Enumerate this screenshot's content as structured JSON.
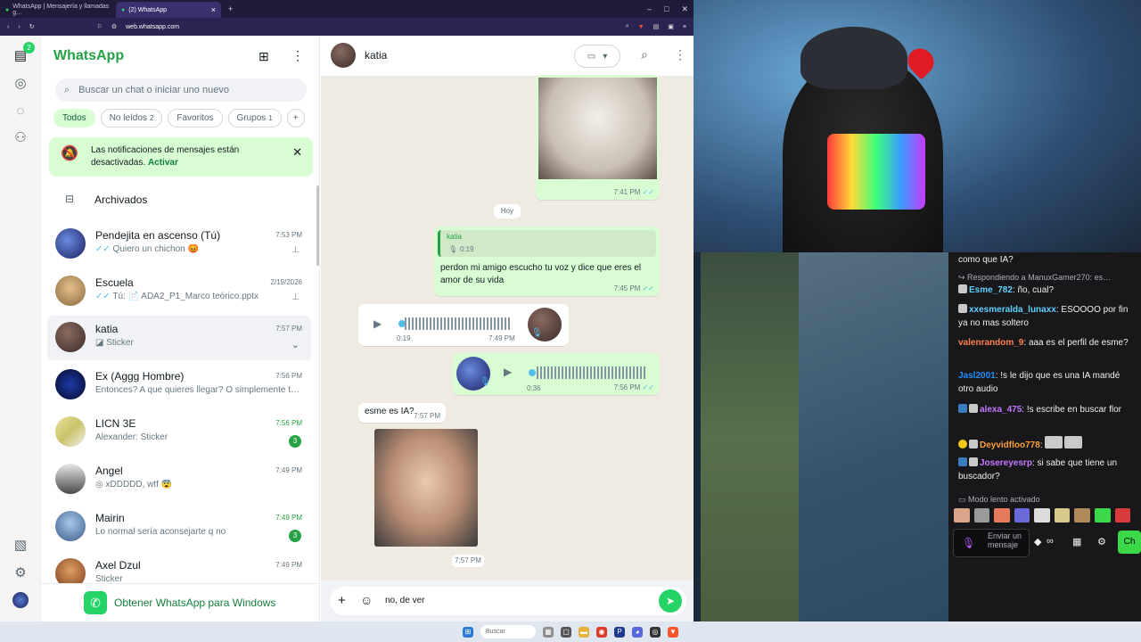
{
  "browser": {
    "tabs": [
      {
        "title": "WhatsApp | Mensajería y llamadas g…"
      },
      {
        "title": "(2) WhatsApp"
      }
    ],
    "url": "web.whatsapp.com"
  },
  "sidebar": {
    "chats_badge": "2"
  },
  "header": {
    "title": "WhatsApp"
  },
  "search": {
    "placeholder": "Buscar un chat o iniciar uno nuevo"
  },
  "filters": [
    {
      "label": "Todos"
    },
    {
      "label": "No leídos",
      "count": "2"
    },
    {
      "label": "Favoritos"
    },
    {
      "label": "Grupos",
      "count": "1"
    }
  ],
  "notification": {
    "text": "Las notificaciones de mensajes están desactivadas.",
    "action": "Activar"
  },
  "archived": {
    "label": "Archivados"
  },
  "chats": [
    {
      "name": "Pendejita en ascenso (Tú)",
      "preview": "Quiero un chichon 😡",
      "time": "7:53 PM"
    },
    {
      "name": "Escuela",
      "preview": "Tú: 📄 ADA2_P1_Marco teórico.pptx",
      "time": "2/19/2026"
    },
    {
      "name": "katia",
      "preview": "Sticker",
      "time": "7:57 PM"
    },
    {
      "name": "Ex (Aggg Hombre)",
      "preview": "Entonces? A que quieres llegar? O simplemente te…",
      "time": "7:56 PM"
    },
    {
      "name": "LICN 3E",
      "preview": "Alexander: Sticker",
      "time": "7:56 PM",
      "unread": "3"
    },
    {
      "name": "Angel",
      "preview": "xDDDDD, wtf 😨",
      "time": "7:49 PM"
    },
    {
      "name": "Mairin",
      "preview": "Lo normal sería aconsejarte q no",
      "time": "7:49 PM",
      "unread": "3"
    },
    {
      "name": "Axel Dzul",
      "preview": "Sticker",
      "time": "7:49 PM"
    }
  ],
  "footer": {
    "get_windows": "Obtener WhatsApp para Windows"
  },
  "conversation": {
    "contact": "katia",
    "day_label": "Hoy",
    "messages": [
      {
        "time": "7:41 PM"
      },
      {
        "quote_name": "katia",
        "quote_audio": "0:19",
        "text": "perdon mi amigo escucho tu voz y dice que eres el amor de su vida",
        "time": "7:45 PM"
      },
      {
        "duration": "0:19",
        "time": "7:49 PM"
      },
      {
        "duration": "0:36",
        "time": "7:56 PM"
      },
      {
        "text": "esme es IA?",
        "time": "7:57 PM"
      },
      {
        "time": "7:57 PM"
      }
    ],
    "composer_value": "no, de ver"
  },
  "taskbar": {
    "search": "Buscar"
  },
  "twitch_chat": [
    {
      "text": "como que IA?"
    },
    {
      "text": "↪ Respondiendo a ManuxGamer270: es…"
    },
    {
      "user": "Esme_782",
      "text": "ño, cual?",
      "color": "#5fd1ff"
    },
    {
      "user": "xxesmeralda_lunaxx",
      "text": "ESOOOO por fin ya no mas soltero",
      "color": "#5fd1ff"
    },
    {
      "user": "valenrandom_9",
      "text": "aaa es el perfil de esme?",
      "color": "#ff7f50"
    },
    {
      "user": "Jasl2001",
      "text": "!s le dijo que es una IA mandé otro audio",
      "color": "#1e90ff"
    },
    {
      "user": "alexa_475",
      "text": "!s escribe en buscar flor",
      "color": "#c678ff"
    },
    {
      "user": "Deyvidfloo778",
      "text": "",
      "color": "#ff9e3d"
    },
    {
      "user": "Josereyesrp",
      "text": "si sabe que tiene un buscador?",
      "color": "#c678ff"
    }
  ],
  "twitch": {
    "slow_mode": "Modo lento activado",
    "send_placeholder": "Enviar un mensaje"
  }
}
